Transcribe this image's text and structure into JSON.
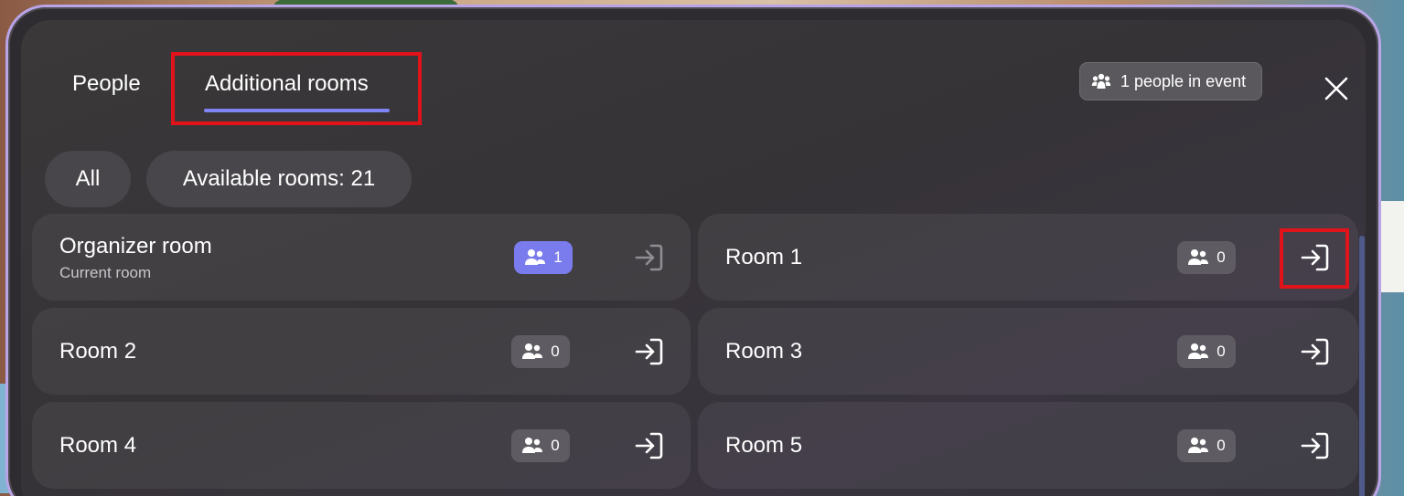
{
  "tabs": {
    "people": "People",
    "additional_rooms": "Additional rooms"
  },
  "event_badge": {
    "text": "1 people in event",
    "icon": "people-group-icon"
  },
  "close_icon": "close-icon",
  "filters": {
    "all": "All",
    "available": "Available rooms: 21"
  },
  "rooms": [
    {
      "name": "Organizer room",
      "subtitle": "Current room",
      "count": "1",
      "active": true
    },
    {
      "name": "Room 1",
      "count": "0"
    },
    {
      "name": "Room 2",
      "count": "0"
    },
    {
      "name": "Room 3",
      "count": "0"
    },
    {
      "name": "Room 4",
      "count": "0"
    },
    {
      "name": "Room 5",
      "count": "0"
    }
  ],
  "colors": {
    "accent": "#7f85f5",
    "highlight": "#e0131b",
    "active_badge": "#7a7bec"
  }
}
